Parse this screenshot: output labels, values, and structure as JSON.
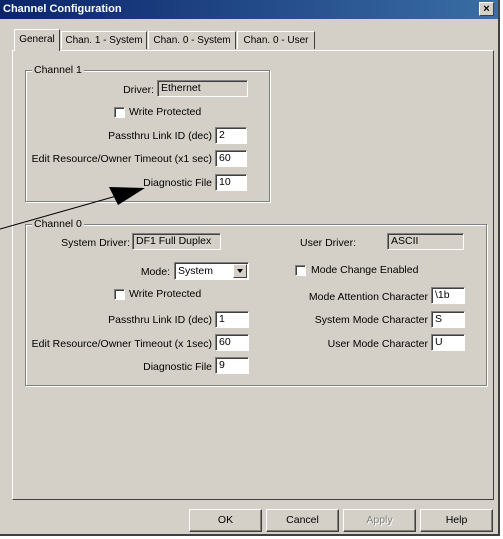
{
  "window": {
    "title": "Channel Configuration",
    "close_label": "×"
  },
  "tabs": [
    {
      "label": "General"
    },
    {
      "label": "Chan. 1 - System"
    },
    {
      "label": "Chan. 0 - System"
    },
    {
      "label": "Chan. 0 - User"
    }
  ],
  "channel1": {
    "group_label": "Channel 1",
    "driver_label": "Driver:",
    "driver_value": "Ethernet",
    "write_protected_label": "Write Protected",
    "passthru_label": "Passthru Link ID (dec)",
    "passthru_value": "2",
    "timeout_label": "Edit Resource/Owner Timeout (x1 sec)",
    "timeout_value": "60",
    "diag_label": "Diagnostic File",
    "diag_value": "10"
  },
  "channel0": {
    "group_label": "Channel 0",
    "system_driver_label": "System Driver:",
    "system_driver_value": "DF1 Full Duplex",
    "user_driver_label": "User Driver:",
    "user_driver_value": "ASCII",
    "mode_label": "Mode:",
    "mode_value": "System",
    "mode_change_label": "Mode Change Enabled",
    "write_protected_label": "Write Protected",
    "mode_attention_label": "Mode Attention Character",
    "mode_attention_value": "\\1b",
    "passthru_label": "Passthru Link ID (dec)",
    "passthru_value": "1",
    "system_mode_char_label": "System Mode Character",
    "system_mode_char_value": "S",
    "timeout_label": "Edit Resource/Owner Timeout (x 1sec)",
    "timeout_value": "60",
    "user_mode_char_label": "User Mode Character",
    "user_mode_char_value": "U",
    "diag_label": "Diagnostic File",
    "diag_value": "9"
  },
  "buttons": {
    "ok": "OK",
    "cancel": "Cancel",
    "apply": "Apply",
    "help": "Help"
  },
  "colors": {
    "titlebar_start": "#0a246a",
    "titlebar_end": "#3a6ea5",
    "face": "#d4d0c8"
  }
}
